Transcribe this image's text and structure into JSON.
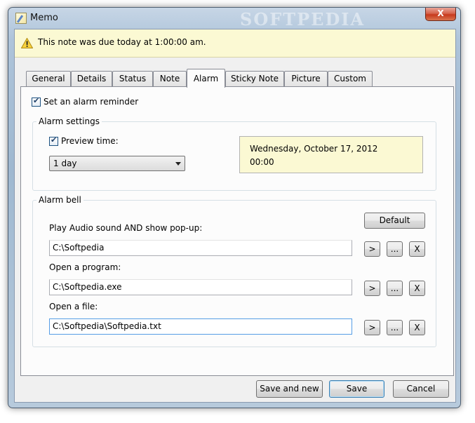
{
  "window": {
    "title": "Memo",
    "watermark": "SOFTPEDIA",
    "close_glyph": "X"
  },
  "infobar": {
    "text": "This note was due today at 1:00:00 am.",
    "icon": "warning-icon"
  },
  "tabs": [
    {
      "label": "General"
    },
    {
      "label": "Details"
    },
    {
      "label": "Status"
    },
    {
      "label": "Note"
    },
    {
      "label": "Alarm",
      "active": true
    },
    {
      "label": "Sticky Note"
    },
    {
      "label": "Picture"
    },
    {
      "label": "Custom"
    }
  ],
  "alarm": {
    "set_reminder_label": "Set an alarm reminder",
    "set_reminder_checked": true,
    "settings": {
      "group_label": "Alarm settings",
      "preview_label": "Preview time:",
      "preview_checked": true,
      "interval_value": "1 day",
      "preview_date": "Wednesday, October 17, 2012",
      "preview_time": "00:00"
    },
    "bell": {
      "group_label": "Alarm bell",
      "default_button": "Default",
      "audio_label": "Play Audio sound AND show pop-up:",
      "audio_value": "C:\\Softpedia",
      "program_label": "Open a program:",
      "program_value": "C:\\Softpedia.exe",
      "file_label": "Open a file:",
      "file_value": "C:\\Softpedia\\Softpedia.txt",
      "play_button": ">",
      "browse_button": "...",
      "clear_button": "X"
    }
  },
  "footer": {
    "save_and_new": "Save and new",
    "save": "Save",
    "cancel": "Cancel"
  },
  "colors": {
    "infobar_bg": "#fbf9d3",
    "focus_border": "#569de5"
  }
}
